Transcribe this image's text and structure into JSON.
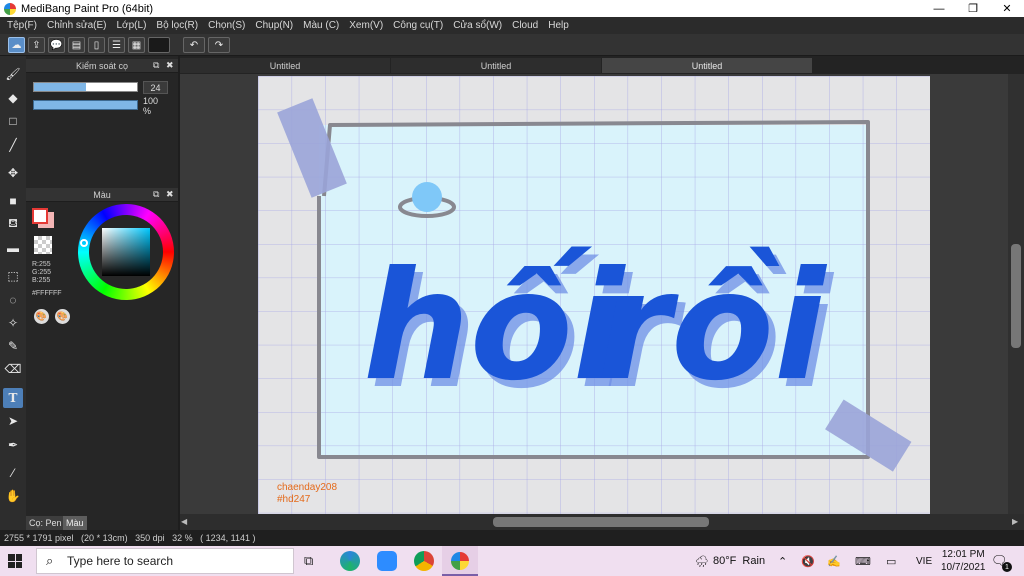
{
  "window": {
    "title": "MediBang Paint Pro (64bit)",
    "minimize": "—",
    "maximize": "❐",
    "close": "✕"
  },
  "menu": [
    "Tệp(F)",
    "Chỉnh sửa(E)",
    "Lớp(L)",
    "Bộ lọc(R)",
    "Chọn(S)",
    "Chụp(N)",
    "Màu (C)",
    "Xem(V)",
    "Công cụ(T)",
    "Cửa sổ(W)",
    "Cloud",
    "Help"
  ],
  "toolbar": {
    "undo_icon": "undo-arrow-icon",
    "redo_icon": "redo-arrow-icon"
  },
  "tabs": [
    {
      "label": "Untitled",
      "active": false
    },
    {
      "label": "Untitled",
      "active": false
    },
    {
      "label": "Untitled",
      "active": true
    }
  ],
  "brush_panel": {
    "title": "Kiểm soát cọ",
    "size_value": "24",
    "size_fraction": 0.5,
    "opacity_value": "100 %",
    "opacity_fraction": 1.0
  },
  "color_panel": {
    "title": "Màu",
    "primary_color": "#FFFFFF",
    "secondary_color": "#e53935",
    "r_label": "R:255",
    "g_label": "G:255",
    "b_label": "B:255",
    "hex_label": "#FFFFFF"
  },
  "bottom_tabs": [
    {
      "label": "Cọ: Pen",
      "active": true
    },
    {
      "label": "Màu",
      "active": false
    }
  ],
  "artwork": {
    "word1": "hối",
    "word2": "rồi",
    "credit_user": "chaenday208",
    "credit_tag": "#hd247",
    "frame_color": "#888890",
    "paper_color": "#d9f3fb",
    "text_color": "#1a55d8",
    "shadow_color": "#6f8fe6",
    "tape_color": "#9aa4d8",
    "credit_color": "#e46a1a"
  },
  "status": {
    "text": "2755 * 1791 pixel   (20 * 13cm)   350 dpi   32 %   ( 1234, 1141 )"
  },
  "taskbar": {
    "search_placeholder": "Type here to search",
    "weather": "80°F  Rain",
    "lang": "VIE",
    "time": "12:01 PM",
    "date": "10/7/2021",
    "notif_count": "1"
  }
}
